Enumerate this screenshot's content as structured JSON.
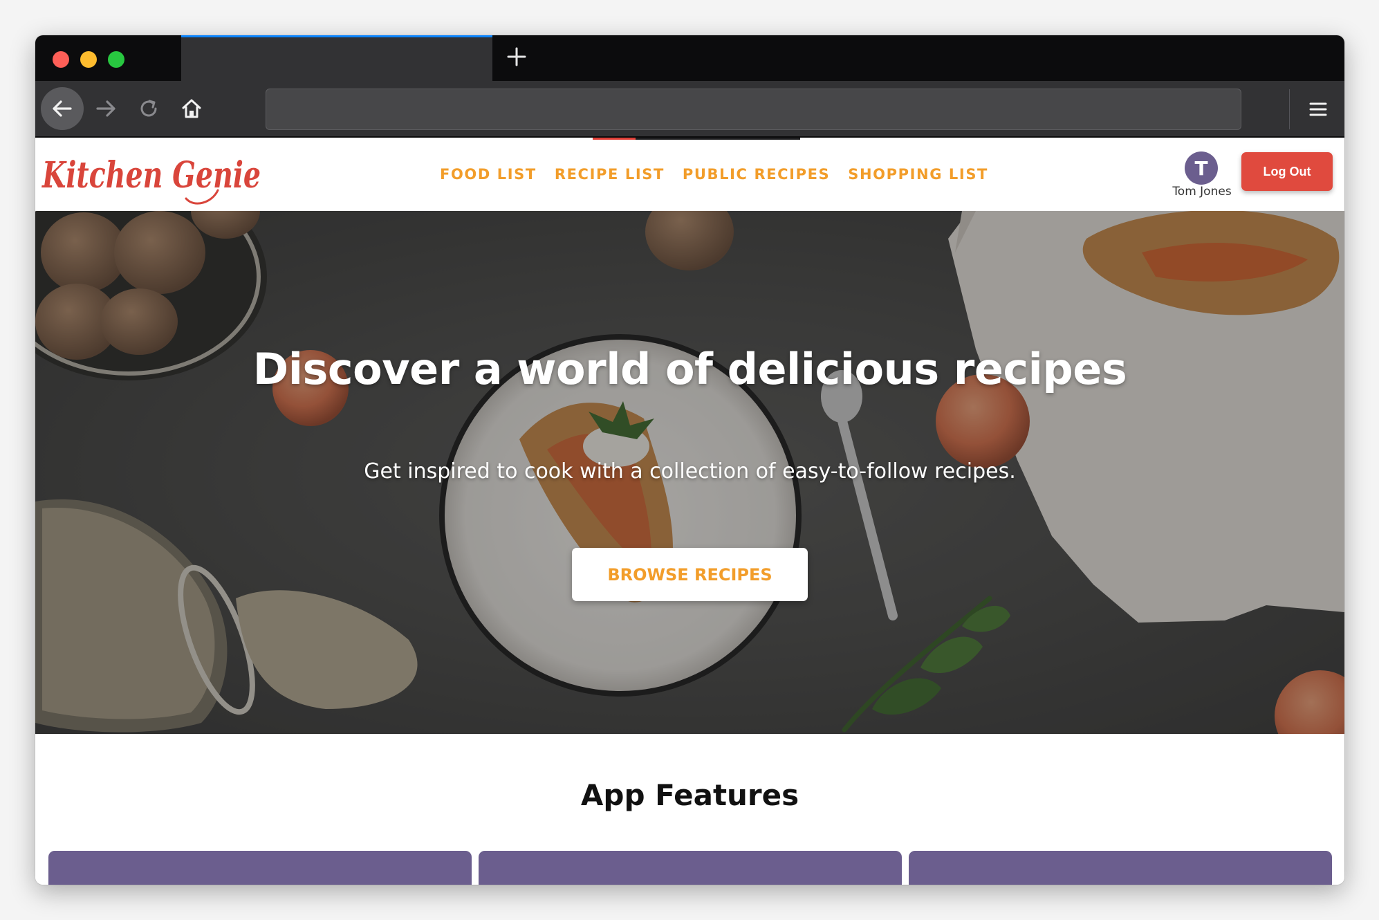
{
  "colors": {
    "tab_accent": "#0a84ff",
    "brand_red": "#e04a3e",
    "nav_orange": "#f29d2a",
    "avatar_purple": "#6b5e8e"
  },
  "browser": {
    "new_tab_icon": "plus-icon",
    "toolbar_icons": [
      "back-arrow-icon",
      "forward-arrow-icon",
      "reload-icon",
      "home-icon",
      "hamburger-menu-icon"
    ]
  },
  "site": {
    "logo_text": "Kitchen Genie",
    "nav": [
      {
        "label": "FOOD LIST"
      },
      {
        "label": "RECIPE LIST"
      },
      {
        "label": "PUBLIC RECIPES"
      },
      {
        "label": "SHOPPING LIST"
      }
    ],
    "user": {
      "initial": "T",
      "name": "Tom Jones"
    },
    "logout_label": "Log Out"
  },
  "hero": {
    "title": "Discover a world of delicious recipes",
    "subtitle": "Get inspired to cook with a collection of easy-to-follow recipes.",
    "cta_label": "BROWSE RECIPES"
  },
  "features": {
    "title": "App Features",
    "cards": [
      {
        "title": ""
      },
      {
        "title": ""
      },
      {
        "title": ""
      }
    ]
  }
}
